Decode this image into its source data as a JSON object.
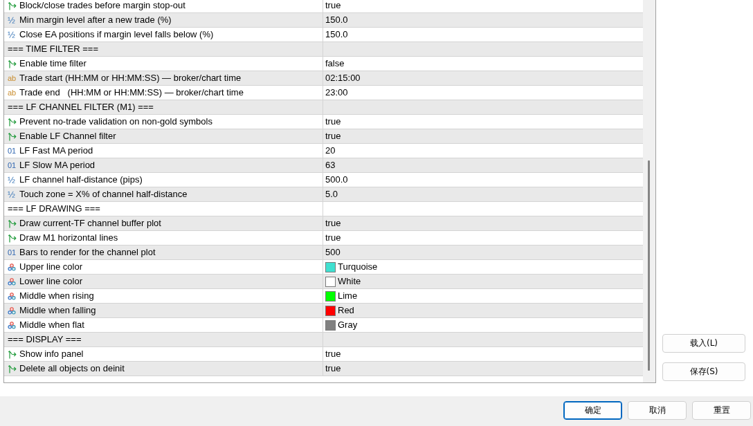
{
  "parameters": {
    "rows": [
      {
        "kind": "bool",
        "name": "Block/close trades before margin stop-out",
        "value": "true"
      },
      {
        "kind": "double",
        "glyph": "½",
        "name": "Min margin level after a new trade (%)",
        "value": "150.0"
      },
      {
        "kind": "double",
        "glyph": "½",
        "name": "Close EA positions if margin level falls below (%)",
        "value": "150.0"
      },
      {
        "kind": "section",
        "name": "=== TIME FILTER ==="
      },
      {
        "kind": "bool",
        "name": "Enable time filter",
        "value": "false"
      },
      {
        "kind": "string",
        "glyph": "ab",
        "name": "Trade start (HH:MM or HH:MM:SS) — broker/chart time",
        "value": "02:15:00"
      },
      {
        "kind": "string",
        "glyph": "ab",
        "name": "Trade end   (HH:MM or HH:MM:SS) — broker/chart time",
        "value": "23:00"
      },
      {
        "kind": "section",
        "name": "=== LF CHANNEL FILTER (M1) ==="
      },
      {
        "kind": "bool",
        "name": "Prevent no-trade validation on non-gold symbols",
        "value": "true"
      },
      {
        "kind": "bool",
        "name": "Enable LF Channel filter",
        "value": "true"
      },
      {
        "kind": "int",
        "glyph": "01",
        "name": "LF Fast MA period",
        "value": "20"
      },
      {
        "kind": "int",
        "glyph": "01",
        "name": "LF Slow MA period",
        "value": "63"
      },
      {
        "kind": "double",
        "glyph": "½",
        "name": "LF channel half-distance (pips)",
        "value": "500.0"
      },
      {
        "kind": "double",
        "glyph": "½",
        "name": "Touch zone = X% of channel half-distance",
        "value": "5.0"
      },
      {
        "kind": "section",
        "name": "=== LF DRAWING ==="
      },
      {
        "kind": "bool",
        "name": "Draw current-TF channel buffer plot",
        "value": "true"
      },
      {
        "kind": "bool",
        "name": "Draw M1 horizontal lines",
        "value": "true"
      },
      {
        "kind": "int",
        "glyph": "01",
        "name": "Bars to render for the channel plot",
        "value": "500"
      },
      {
        "kind": "color",
        "name": "Upper line color",
        "value": "Turquoise",
        "color": "#40e0d0"
      },
      {
        "kind": "color",
        "name": "Lower line color",
        "value": "White",
        "color": "#ffffff"
      },
      {
        "kind": "color",
        "name": "Middle when rising",
        "value": "Lime",
        "color": "#00ff00"
      },
      {
        "kind": "color",
        "name": "Middle when falling",
        "value": "Red",
        "color": "#ff0000"
      },
      {
        "kind": "color",
        "name": "Middle when flat",
        "value": "Gray",
        "color": "#808080"
      },
      {
        "kind": "section",
        "name": "=== DISPLAY ==="
      },
      {
        "kind": "bool",
        "name": "Show info panel",
        "value": "true"
      },
      {
        "kind": "bool",
        "name": "Delete all objects on deinit",
        "value": "true"
      }
    ]
  },
  "side_buttons": [
    {
      "label": "载入(L)"
    },
    {
      "label": "保存(S)"
    }
  ],
  "footer_buttons": [
    {
      "label": "确定",
      "default": true
    },
    {
      "label": "取消",
      "default": false
    },
    {
      "label": "重置",
      "default": false
    }
  ]
}
